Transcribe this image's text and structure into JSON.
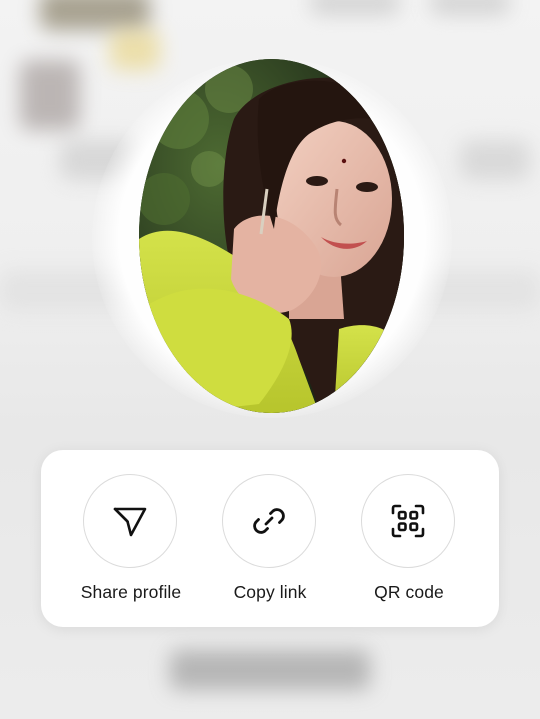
{
  "share_sheet": {
    "options": [
      {
        "label": "Share profile",
        "icon": "paper-plane-icon"
      },
      {
        "label": "Copy link",
        "icon": "link-icon"
      },
      {
        "label": "QR code",
        "icon": "qr-code-icon"
      }
    ]
  },
  "colors": {
    "sheet_background": "#ffffff",
    "icon_stroke": "#111111",
    "circle_border": "#dbdbdb",
    "label_text": "#1a1a1a",
    "jacket": "#c9d83a"
  }
}
